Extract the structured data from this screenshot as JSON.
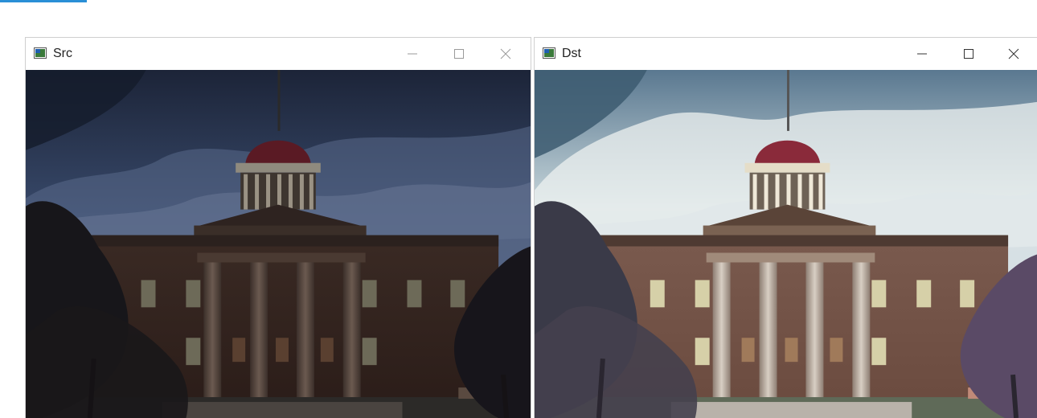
{
  "windows": [
    {
      "id": "src",
      "title": "Src"
    },
    {
      "id": "dst",
      "title": "Dst"
    }
  ],
  "icons": {
    "app": "opencv-window-icon",
    "minimize": "minimize-icon",
    "maximize": "maximize-icon",
    "close": "close-icon"
  },
  "colors": {
    "accent": "#2a8fd6",
    "src_sky": "#2b3a55",
    "dst_sky": "#b9cfd8",
    "dome": "#8a2a3a"
  }
}
